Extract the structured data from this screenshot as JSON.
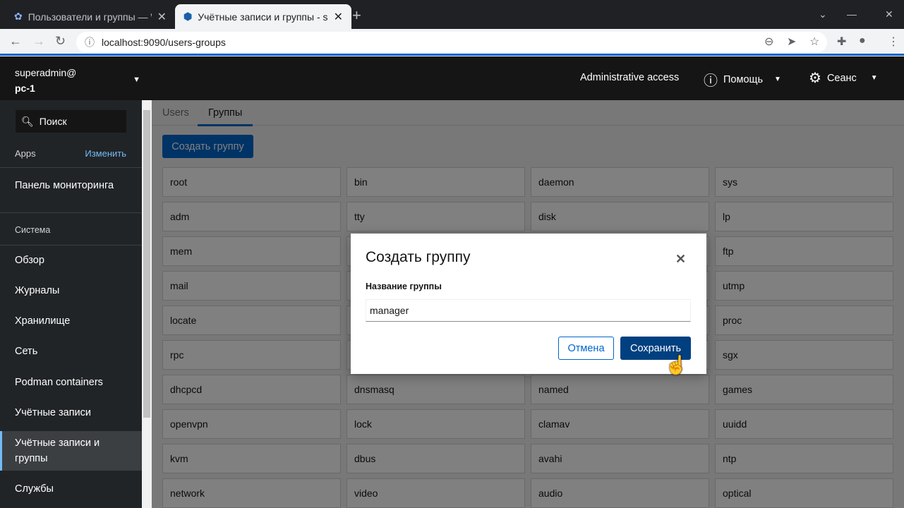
{
  "browser": {
    "tabs": [
      {
        "title": "Пользователи и группы — W"
      },
      {
        "title": "Учётные записи и группы - su"
      }
    ],
    "url": "localhost:9090/users-groups"
  },
  "sidebar": {
    "user": "superadmin@",
    "host": "pc-1",
    "search": "Поиск",
    "apps_label": "Apps",
    "edit_label": "Изменить",
    "dashboard": "Панель мониторинга",
    "section": "Система",
    "items": [
      {
        "label": "Обзор"
      },
      {
        "label": "Журналы"
      },
      {
        "label": "Хранилище"
      },
      {
        "label": "Сеть"
      },
      {
        "label": "Podman containers"
      },
      {
        "label": "Учётные записи"
      },
      {
        "label": "Учётные записи и группы"
      },
      {
        "label": "Службы"
      }
    ]
  },
  "header": {
    "admin": "Administrative access",
    "help": "Помощь",
    "session": "Сеанс"
  },
  "page": {
    "tabs": [
      "Users",
      "Группы"
    ],
    "create_button": "Создать группу",
    "groups": [
      "root",
      "bin",
      "daemon",
      "sys",
      "adm",
      "tty",
      "disk",
      "lp",
      "mem",
      "",
      "",
      "ftp",
      "mail",
      "",
      "",
      "utmp",
      "locate",
      "",
      "",
      "proc",
      "rpc",
      "",
      "",
      "sgx",
      "dhcpcd",
      "dnsmasq",
      "named",
      "games",
      "openvpn",
      "lock",
      "clamav",
      "uuidd",
      "kvm",
      "dbus",
      "avahi",
      "ntp",
      "network",
      "video",
      "audio",
      "optical"
    ]
  },
  "modal": {
    "title": "Создать группу",
    "field_label": "Название группы",
    "field_value": "manager",
    "cancel": "Отмена",
    "save": "Сохранить"
  }
}
